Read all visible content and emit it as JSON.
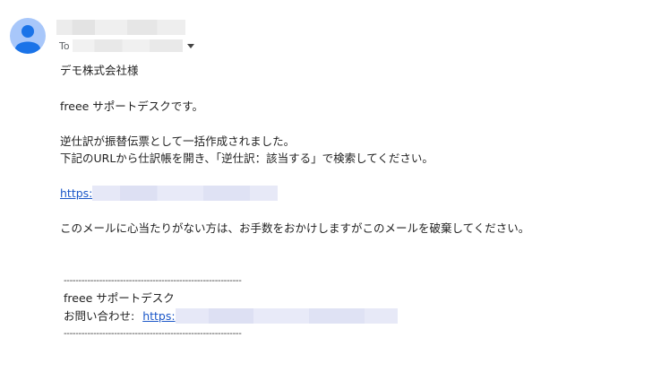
{
  "header": {
    "to_label": "To"
  },
  "message": {
    "greeting": "デモ株式会社様",
    "intro": "freee サポートデスクです。",
    "line1": "逆仕訳が振替伝票として一括作成されました。",
    "line2": "下記のURLから仕訳帳を開き、「逆仕訳：該当する」で検索してください。",
    "link_prefix": "https:",
    "notice": "このメールに心当たりがない方は、お手数をおかけしますがこのメールを破棄してください。"
  },
  "signature": {
    "rule": "------------------------------------------------------------",
    "name": "freee サポートデスク",
    "contact_label": "お問い合わせ:",
    "contact_link_prefix": "https:"
  },
  "icons": {
    "avatar": "person-icon",
    "to_dropdown": "caret-down-icon"
  },
  "colors": {
    "link": "#1a56c8",
    "avatar_bg": "#a8c7fa",
    "avatar_fg": "#1a73e8"
  }
}
